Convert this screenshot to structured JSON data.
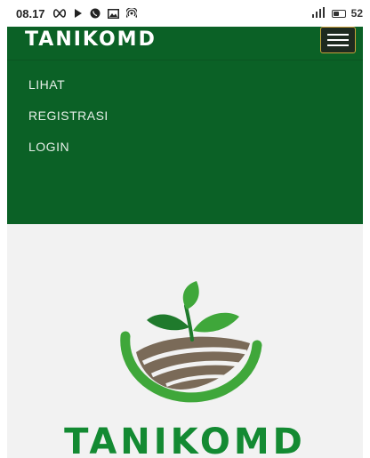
{
  "status_bar": {
    "time": "08.17",
    "battery_level": "52",
    "battery_fraction": 0.52,
    "icons": [
      "loop-icon",
      "play-icon",
      "whatsapp-icon",
      "image-icon",
      "wifi-hotspot-icon",
      "signal-icon",
      "battery-icon"
    ]
  },
  "navbar": {
    "brand": "TANIKOMD",
    "toggle_icon": "hamburger-menu-icon",
    "links": [
      {
        "label": "LIHAT"
      },
      {
        "label": "REGISTRASI"
      },
      {
        "label": "LOGIN"
      }
    ]
  },
  "hero": {
    "logo_icon": "sprout-field-logo",
    "logo_text": "TANIKOMD"
  },
  "colors": {
    "nav_background": "#0b6126",
    "logo_green": "#3fa73a",
    "logo_dark_green": "#1f7a2c",
    "soil_brown": "#7a6a58",
    "hero_background": "#f2f2f2"
  }
}
